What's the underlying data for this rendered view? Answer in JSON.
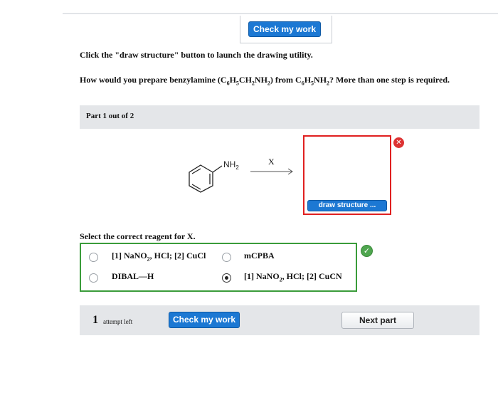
{
  "header": {
    "check_label": "Check my work"
  },
  "instructions": "Click the \"draw structure\" button to launch the drawing utility.",
  "question": {
    "t1": "How would you prepare benzylamine (C",
    "s1": "6",
    "t2": "H",
    "s2": "5",
    "t3": "CH",
    "s3": "2",
    "t4": "NH",
    "s4": "2",
    "t5": ") from C",
    "s5": "6",
    "t6": "H",
    "s6": "5",
    "t7": "NH",
    "s7": "2",
    "t8": "? More than one step is required."
  },
  "part": {
    "label": "Part 1 out of 2"
  },
  "reaction": {
    "amine_label": "NH",
    "amine_sub": "2",
    "reagent_label": "X"
  },
  "draw": {
    "button_label": "draw structure ...",
    "remove_icon": "x-circle-icon"
  },
  "select": {
    "prompt": "Select the correct reagent for X.",
    "options": [
      {
        "pre": "[1] NaNO",
        "sub": "2",
        "post": ", HCl; [2] CuCl",
        "selected": false
      },
      {
        "pre": "mCPBA",
        "sub": "",
        "post": "",
        "selected": false
      },
      {
        "pre": "DIBAL—H",
        "sub": "",
        "post": "",
        "selected": false
      },
      {
        "pre": "[1] NaNO",
        "sub": "2",
        "post": ", HCl; [2] CuCN",
        "selected": true
      }
    ],
    "status_icon": "checkmark-circle-icon",
    "status_color": "#4fa64f"
  },
  "footer": {
    "attempts_count": "1",
    "attempts_text": "attempt left",
    "check_label": "Check my work",
    "next_label": "Next part"
  },
  "colors": {
    "accent": "#1c78d3",
    "error": "#e02020",
    "success": "#3a9c3a"
  }
}
